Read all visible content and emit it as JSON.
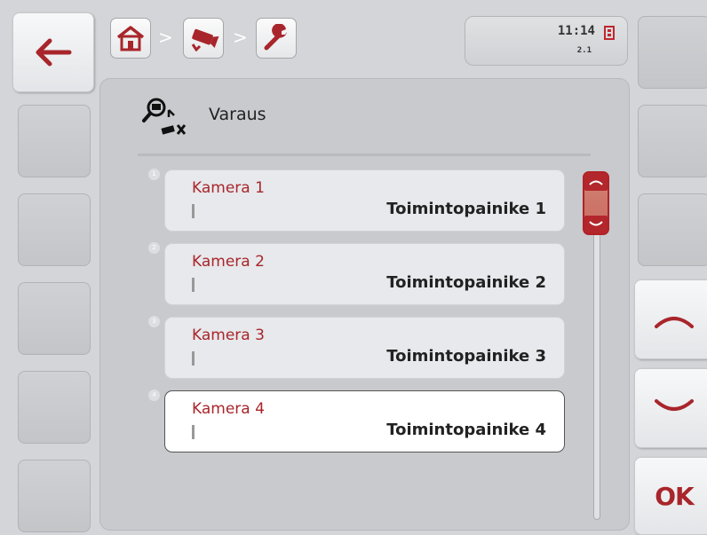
{
  "breadcrumb": {
    "icons": [
      "home-icon",
      "camera-icon",
      "wrench-icon"
    ],
    "separator": ">"
  },
  "status": {
    "time": "11:14",
    "version": "2.1",
    "icon": "sd-card-icon"
  },
  "header": {
    "title": "Varaus",
    "icon": "camera-search-icon"
  },
  "list": {
    "rows": [
      {
        "index": "1",
        "name": "Kamera 1",
        "value": "Toimintopainike 1",
        "selected": false
      },
      {
        "index": "2",
        "name": "Kamera 2",
        "value": "Toimintopainike 2",
        "selected": false
      },
      {
        "index": "3",
        "name": "Kamera 3",
        "value": "Toimintopainike 3",
        "selected": false
      },
      {
        "index": "4",
        "name": "Kamera 4",
        "value": "Toimintopainike 4",
        "selected": true
      }
    ]
  },
  "softkeys": {
    "back_icon": "arrow-left-icon",
    "up_icon": "chevron-up-icon",
    "down_icon": "chevron-down-icon",
    "ok_label": "OK"
  },
  "colors": {
    "accent": "#a8262b",
    "background": "#d3d5d8"
  }
}
